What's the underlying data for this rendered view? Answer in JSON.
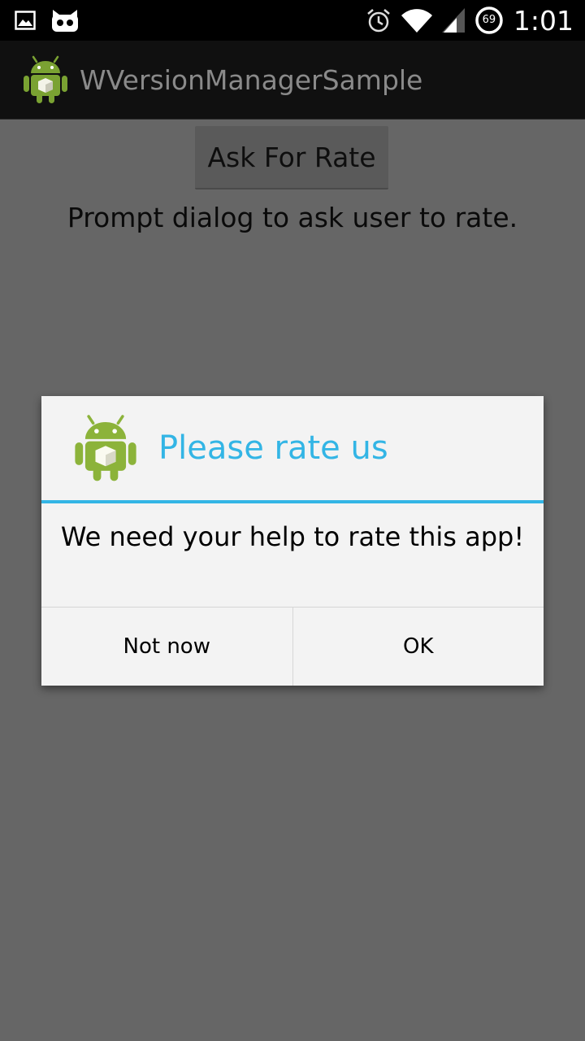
{
  "status_bar": {
    "time": "1:01",
    "battery_level": "69",
    "icons": [
      "picture-icon",
      "cyanogen-mascot-icon",
      "alarm-icon",
      "wifi-icon",
      "signal-icon",
      "battery-icon"
    ]
  },
  "action_bar": {
    "title": "WVersionManagerSample",
    "icon": "android-app-icon"
  },
  "main": {
    "rate_button_label": "Ask For Rate",
    "description": "Prompt dialog to ask user to rate."
  },
  "dialog": {
    "title": "Please rate us",
    "message": "We need your help to rate this app!",
    "negative_label": "Not now",
    "positive_label": "OK",
    "icon": "android-app-icon"
  },
  "colors": {
    "accent": "#33b5e5",
    "android_green": "#8cb33a",
    "scrim_background": "#666666"
  }
}
